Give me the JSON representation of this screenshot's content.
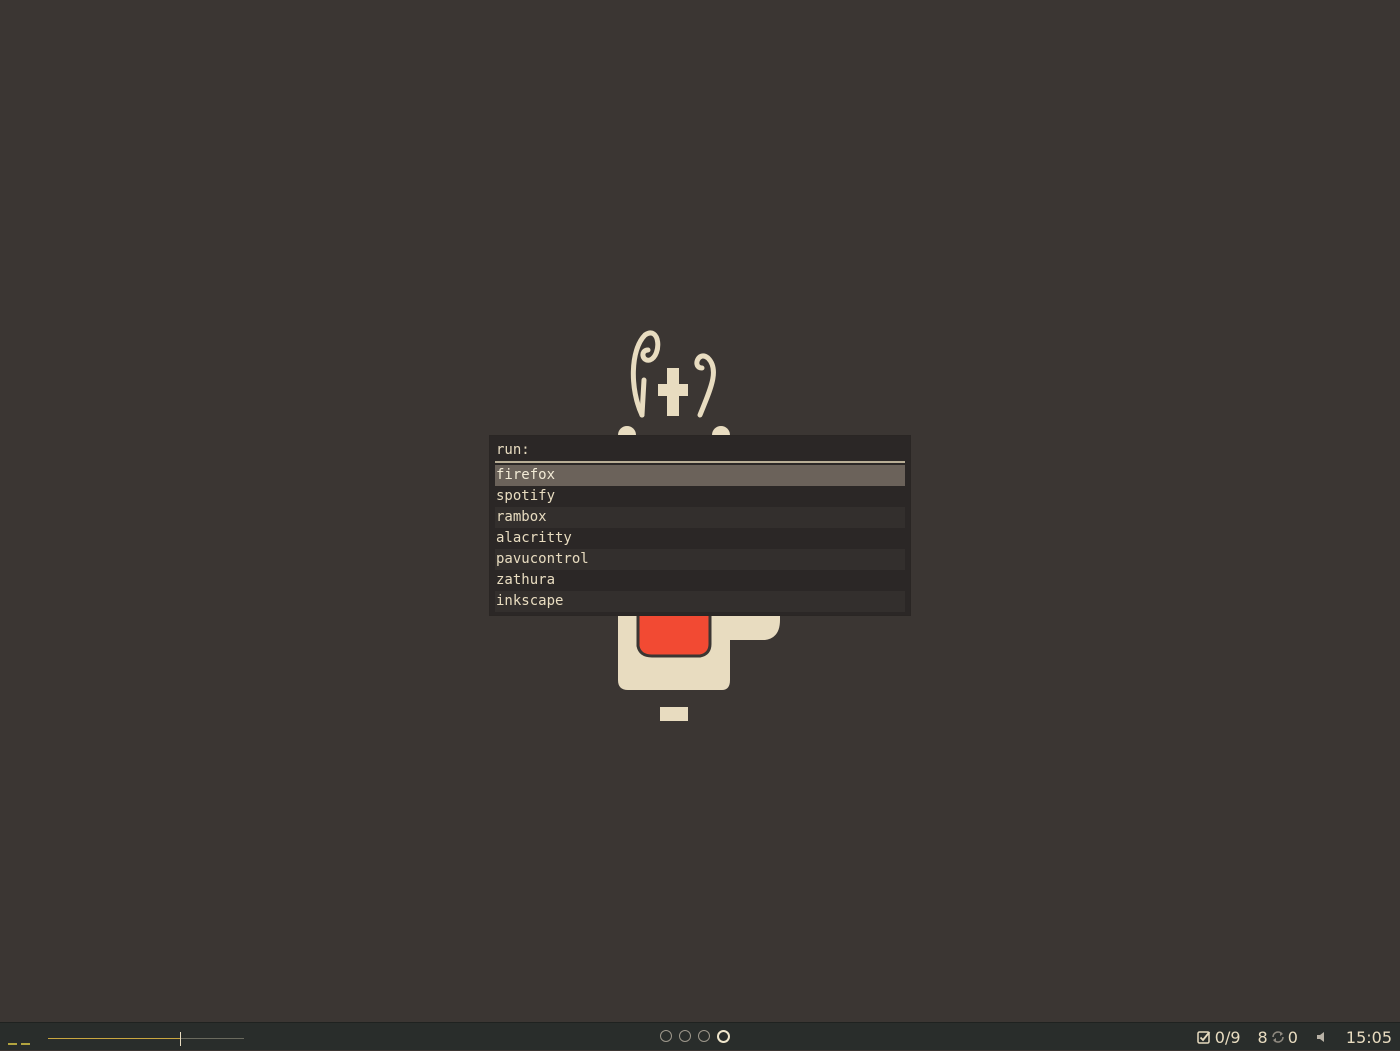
{
  "wallpaper": {
    "background_color": "#3b3633",
    "logo_icon": "coffee-dispenser-logo"
  },
  "launcher": {
    "prompt": "run:",
    "input_value": "",
    "selected_index": 0,
    "items": [
      {
        "label": "firefox"
      },
      {
        "label": "spotify"
      },
      {
        "label": "rambox"
      },
      {
        "label": "alacritty"
      },
      {
        "label": "pavucontrol"
      },
      {
        "label": "zathura"
      },
      {
        "label": "inkscape"
      }
    ]
  },
  "statusbar": {
    "layout_icon": "tile-layout-icon",
    "slider_level": 0.68,
    "workspaces": [
      {
        "active": false
      },
      {
        "active": false
      },
      {
        "active": false
      },
      {
        "active": true
      }
    ],
    "tasks": "0/9",
    "updates_count": "8",
    "sync_count": "0",
    "volume_icon": "speaker-icon",
    "clock": "15:05",
    "accent_color": "#c8a640"
  }
}
